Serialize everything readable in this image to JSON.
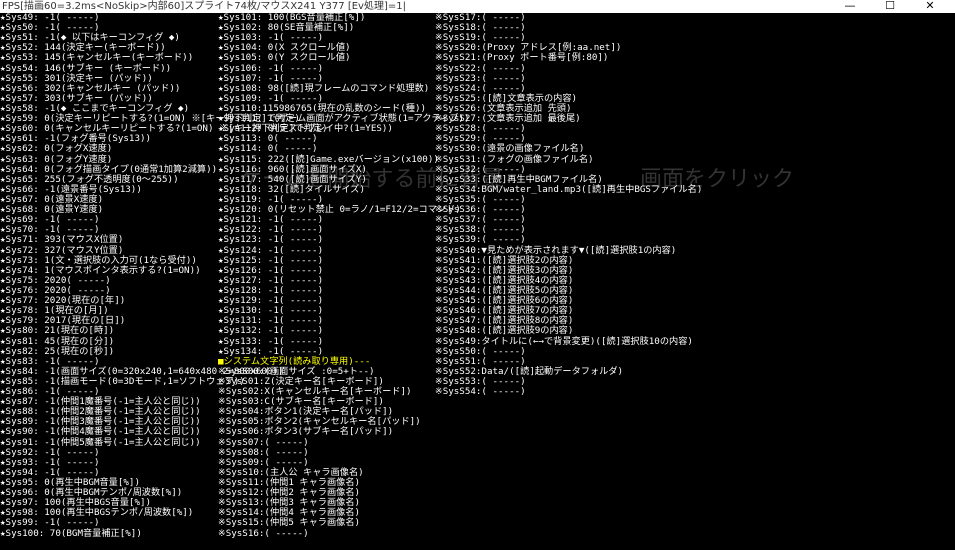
{
  "window": {
    "title": "FPS[描画60=3.2ms<NoSkip>内部60]スプライト74枚/マウスX241 Y377 [Ev処理]=1|",
    "minimize": "—",
    "maximize": "☐",
    "close": "✕"
  },
  "columns": [
    [
      "★Sys49:    -1( -----)",
      "★Sys50:    -1( -----)",
      "★Sys51:    -1(◆ 以下はキーコンフィグ ◆)",
      "★Sys52:   144(決定キー(キーボード))",
      "★Sys53:   145(キャンセルキー(キーボード))",
      "★Sys54:   146(サブキー (キーボード))",
      "★Sys55:   301(決定キー (パッド))",
      "★Sys56:   302(キャンセルキー (パッド))",
      "★Sys57:   303(サブキー (パッド))",
      "★Sys58:    -1(◆ ここまでキーコンフィグ ◆)",
      "★Sys59:     0(決定キーリピートする?(1=ON) ※[キー押下判定]で判定)",
      "★Sys60:     0(キャンセルキーリピートする?(1=ON) ※[キー押下判定]で判定)",
      "★Sys61:    -1(フォグ番号(Sys13))",
      "★Sys62:     0(フォグX速度)",
      "★Sys63:     0(フォグY速度)",
      "★Sys64:     0(フォグ描画タイプ(0通常1加算2減算))",
      "★Sys65:   255(フォグ不透明度(0～255))",
      "★Sys66:    -1(遠景番号(Sys13))",
      "★Sys67:     0(遠景X速度)",
      "★Sys68:     0(遠景Y速度)",
      "★Sys69:    -1( -----)",
      "★Sys70:    -1( -----)",
      "★Sys71:   393(マウスX位置)",
      "★Sys72:   327(マウスY位置)",
      "★Sys73:     1(文・選択肢の入力可(1なら受付))",
      "★Sys74:     1(マウスポインタ表示する?(1=ON))",
      "★Sys75:  2020( -----)",
      "★Sys76:  2020( -----)",
      "★Sys77:  2020(現在の[年])",
      "★Sys78:     1(現在の[月])",
      "★Sys79:  2017(現在の[日])",
      "★Sys80:    21(現在の[時])",
      "★Sys81:    45(現在の[分])",
      "★Sys82:    25(現在の[秒])",
      "★Sys83:    -1( -----)",
      "★Sys84:    -1(画面サイズ(0=320x240,1=640x480 2=800x600))",
      "★Sys85:    -1(描画モード(0=3Dモード,1=ソフトウェア))",
      "★Sys86:    -1( -----)",
      "★Sys87:    -1(仲間1魔番号(-1=主人公と同じ))",
      "★Sys88:    -1(仲間2魔番号(-1=主人公と同じ))",
      "★Sys89:    -1(仲間3魔番号(-1=主人公と同じ))",
      "★Sys90:    -1(仲間4魔番号(-1=主人公と同じ))",
      "★Sys91:    -1(仲間5魔番号(-1=主人公と同じ))",
      "★Sys92:    -1( -----)",
      "★Sys93:    -1( -----)",
      "★Sys94:    -1( -----)",
      "★Sys95:     0(再生中BGM音量[%])",
      "★Sys96:     0(再生中BGMテンポ/周波数[%])",
      "★Sys97:   100(再生中BGS音量[%])",
      "★Sys98:   100(再生中BGSテンポ/周波数[%])",
      "★Sys99:    -1( -----)",
      "★Sys100:   70(BGM音量補正[%])"
    ],
    [
      "★Sys101:   100(BGS音量補正[%])",
      "★Sys102:    80(SE音量補正[%])",
      "★Sys103:    -1( -----)",
      "★Sys104:     0(X スクロール値)",
      "★Sys105:     0(Y スクロール値)",
      "★Sys106:    -1( -----)",
      "★Sys107:    -1( -----)",
      "★Sys108:    98([読]現フレームのコマンド処理数)",
      "★Sys109:    -1( -----)",
      "★Sys110:115986765(現在の乱数のシード(種))",
      "★Sys111:     1(ゲーム画面がアクティブ状態(1=アクティブ))",
      "★Sys112:     0(テストプレイ中?(1=YES))",
      "★Sys113:     0( -----)",
      "★Sys114:     0( -----)",
      "★Sys115:   222([読]Game.exeバージョン(x100))",
      "★Sys116:   960([読]画面サイズX)",
      "★Sys117:   540([読]画面サイズY)",
      "★Sys118:    32([読]タイルサイズ)",
      "★Sys119:    -1( -----)",
      "★Sys120:     0(リセット禁止 0=ラノ/1=F12/2=コマンド)",
      "★Sys121:    -1( -----)",
      "★Sys122:    -1( -----)",
      "★Sys123:    -1( -----)",
      "★Sys124:    -1( -----)",
      "★Sys125:    -1( -----)",
      "★Sys126:    -1( -----)",
      "★Sys127:    -1( -----)",
      "★Sys128:    -1( -----)",
      "★Sys129:    -1( -----)",
      "★Sys130:    -1( -----)",
      "★Sys131:    -1( -----)",
      "★Sys132:    -1( -----)",
      "★Sys133:    -1( -----)",
      "★Sys134:    -1( -----)",
      "■システム文字列(読み取り専用)---",
      "※SysS00:(画面サイズ :0=5+ト--)",
      "※SysS01:Z(決定キー名[キーボード])",
      "※SysS02:X(キャンセルキー名[キーボード])",
      "※SysS03:C(サブキー名[キーボード])",
      "※SysS04:ボタン1(決定キー名[パッド])",
      "※SysS05:ボタン2(キャンセルキー名[パッド])",
      "※SysS06:ボタン3(サブキー名[パッド])",
      "※SysS07:( -----)",
      "※SysS08:( -----)",
      "※SysS09:( -----)",
      "※SysS10:(主人公 キャラ画像名)",
      "※SysS11:(仲間1 キャラ画像名)",
      "※SysS12:(仲間2 キャラ画像名)",
      "※SysS13:(仲間3 キャラ画像名)",
      "※SysS14:(仲間4 キャラ画像名)",
      "※SysS15:(仲間5 キャラ画像名)",
      "※SysS16:( -----)"
    ],
    [
      "※SysS17:( -----)",
      "※SysS18:( -----)",
      "※SysS19:( -----)",
      "※SysS20:(Proxy アドレス[例:aa.net])",
      "※SysS21:(Proxy ポート番号[例:80])",
      "※SysS22:( -----)",
      "※SysS23:( -----)",
      "※SysS24:( -----)",
      "※SysS25:([読]文章表示の内容)",
      "※SysS26:(文章表示追加 先頭)",
      "※SysS27:(文章表示追加 最後尾)",
      "※SysS28:( -----)",
      "※SysS29:( -----)",
      "※SysS30:(遠景の画像ファイル名)",
      "※SysS31:(フォグの画像ファイル名)",
      "※SysS32:( -----)",
      "※SysS33:([読]再生中BGMファイル名)",
      "※SysS34:BGM/water_land.mp3([読]再生中BGSファイル名)",
      "※SysS35:( -----)",
      "※SysS36:( -----)",
      "※SysS37:( -----)",
      "※SysS38:( -----)",
      "※SysS39:( -----)",
      "※SysS40:▼見ためが表示されます▼([読]選択肢1の内容)",
      "※SysS41:([読]選択肢2の内容)",
      "※SysS42:([読]選択肢3の内容)",
      "※SysS43:([読]選択肢4の内容)",
      "※SysS44:([読]選択肢5の内容)",
      "※SysS45:([読]選択肢6の内容)",
      "※SysS46:([読]選択肢7の内容)",
      "※SysS47:([読]選択肢8の内容)",
      "※SysS48:([読]選択肢9の内容)",
      "※SysS49:タイトルに(←→で背景変更)([読]選択肢10の内容)",
      "※SysS50:( -----)",
      "※SysS51:( -----)",
      "※SysS52:Data/([読]起動データフォルダ)",
      "※SysS53:( -----)",
      "※SysS54:( -----)",
      "",
      "",
      "",
      "",
      "",
      "",
      "",
      "",
      "",
      "",
      "",
      "",
      "",
      ""
    ]
  ],
  "ghost_text": [
    "ゲームを開始する前に背景",
    "画面をクリック"
  ]
}
